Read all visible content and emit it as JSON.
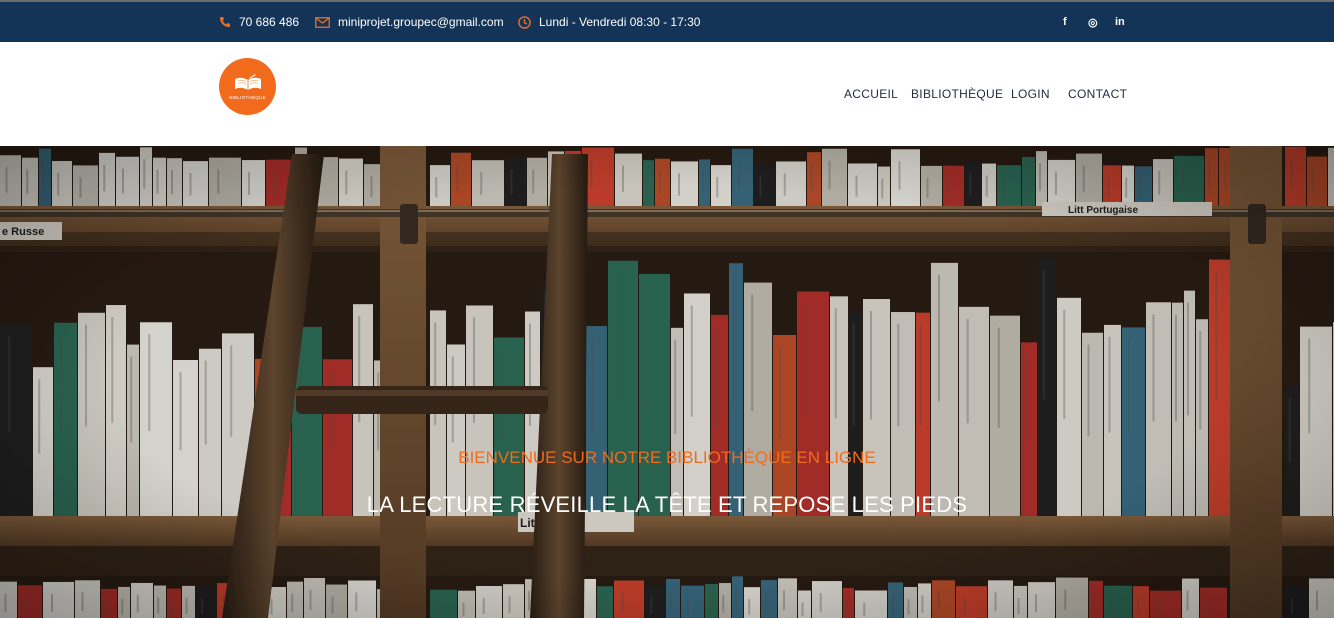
{
  "topbar": {
    "phone": "70 686 486",
    "email": "miniprojet.groupec@gmail.com",
    "hours": "Lundi - Vendredi 08:30 - 17:30",
    "social": [
      "f",
      "◎",
      "in"
    ]
  },
  "logo": {
    "text": "BIBLIOTHEQUE"
  },
  "nav": {
    "items": [
      "ACCUEIL",
      "BIBLIOTHÈQUE",
      "LOGIN",
      "CONTACT"
    ]
  },
  "hero": {
    "subtitle": "BIENVENUE SUR NOTRE BIBLIOTHÈQUE EN LIGNE",
    "title": "LA LECTURE RÉVEILLE LA TÊTE ET REPOSE LES PIEDS",
    "shelf_labels": [
      "e Russe",
      "Litt Portugaise",
      "Lit panique"
    ]
  },
  "colors": {
    "topbar_bg": "#143457",
    "accent": "#f26b1d",
    "nav_text": "#1f2a3a",
    "hero_title": "#ffffff"
  },
  "icons": [
    "phone-icon",
    "envelope-icon",
    "clock-icon",
    "facebook-icon",
    "instagram-icon",
    "linkedin-icon",
    "book-logo-icon"
  ]
}
